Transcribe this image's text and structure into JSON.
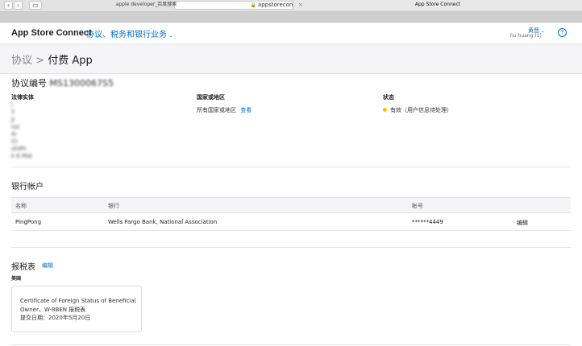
{
  "browser": {
    "url": "appstoreconnect.apple.com",
    "tabs": [
      "apple developer_百度搜索",
      "App Store Connect"
    ]
  },
  "header": {
    "brand": "App Store Connect",
    "section_menu": "协议、税务和银行业务",
    "user_name": "黄晋",
    "user_sub": "hu huang (1)",
    "help": "?"
  },
  "breadcrumb": {
    "parent": "协议",
    "separator": ">",
    "current": "付费 App"
  },
  "agreement": {
    "title_prefix": "协议编号",
    "number": "MS1300067S5",
    "legal_entity_label": "法律实体",
    "legal_entity_lines": [
      "i",
      "T",
      "Ji",
      "nsl",
      "ih",
      "Ct",
      "shiPh",
      "k 6 Mat"
    ],
    "region_label": "国家或地区",
    "region_value": "所有国家或地区",
    "region_link": "查看",
    "status_label": "状态",
    "status_value": "有效（用户信息待处理）",
    "status_color": "#f5c400"
  },
  "bank": {
    "title": "银行帐户",
    "columns": [
      "名称",
      "银行",
      "帐号"
    ],
    "rows": [
      {
        "name": "PingPong",
        "bank": "Wells Fargo Bank, National Association",
        "account": "******4449",
        "action": "编辑"
      }
    ]
  },
  "tax": {
    "title": "报税表",
    "edit": "编辑",
    "country": "美国",
    "form_lines": [
      "Certificate of Foreign Status of Beneficial",
      "Owner，W-8BEN 报税表",
      "提交日期：2020年5月20日"
    ]
  },
  "colors": {
    "accent": "#0070c9",
    "band": "#f5f5f7"
  }
}
